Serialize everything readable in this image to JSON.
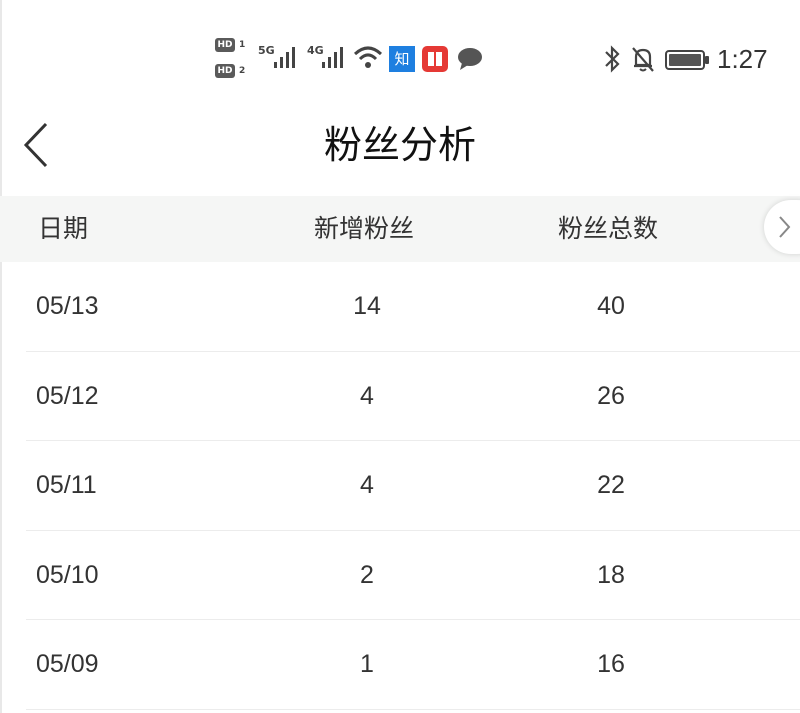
{
  "status_bar": {
    "sim1_badge": "HD",
    "sim1_num": "1",
    "sim2_badge": "HD",
    "sim2_num": "2",
    "net1": "5G",
    "net2": "4G",
    "zhihu_icon_label": "知",
    "time": "1:27",
    "icons": [
      "signal-icon",
      "wifi-icon",
      "zhihu-app-icon",
      "book-app-icon",
      "chat-icon",
      "bluetooth-icon",
      "bell-off-icon",
      "battery-icon"
    ]
  },
  "header": {
    "title": "粉丝分析",
    "back_icon": "chevron-left-icon"
  },
  "table": {
    "columns": [
      "日期",
      "新增粉丝",
      "粉丝总数"
    ],
    "rows": [
      {
        "date": "05/13",
        "new": "14",
        "total": "40"
      },
      {
        "date": "05/12",
        "new": "4",
        "total": "26"
      },
      {
        "date": "05/11",
        "new": "4",
        "total": "22"
      },
      {
        "date": "05/10",
        "new": "2",
        "total": "18"
      },
      {
        "date": "05/09",
        "new": "1",
        "total": "16"
      }
    ],
    "scroll_icon": "chevron-right-icon"
  },
  "colors": {
    "header_bg": "#f5f6f5",
    "divider": "#ececec",
    "zhihu_blue": "#1e7fe0",
    "book_red": "#e53935"
  }
}
